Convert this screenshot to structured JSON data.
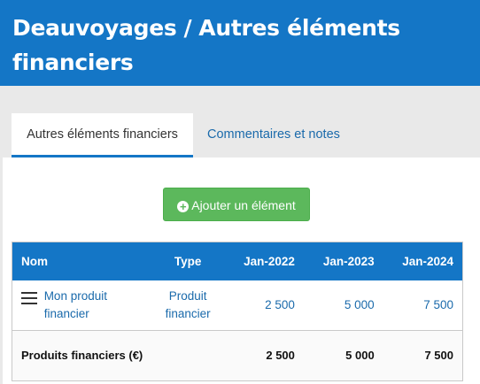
{
  "header": {
    "company": "Deauvoyages",
    "separator": "/",
    "section": "Autres éléments financiers"
  },
  "tabs": [
    {
      "label": "Autres éléments financiers",
      "active": true
    },
    {
      "label": "Commentaires et notes",
      "active": false
    }
  ],
  "add_button": {
    "label": "Ajouter un élément",
    "icon": "plus-circle-icon"
  },
  "table": {
    "columns": [
      "Nom",
      "Type",
      "Jan-2022",
      "Jan-2023",
      "Jan-2024"
    ],
    "rows": [
      {
        "name": "Mon produit financier",
        "type": "Produit financier",
        "values": [
          "2 500",
          "5 000",
          "7 500"
        ]
      }
    ],
    "total": {
      "label": "Produits financiers (€)",
      "values": [
        "2 500",
        "5 000",
        "7 500"
      ]
    }
  },
  "colors": {
    "brand_blue": "#1476c6",
    "link_blue": "#1a6aab",
    "success_green": "#5cb85c"
  }
}
